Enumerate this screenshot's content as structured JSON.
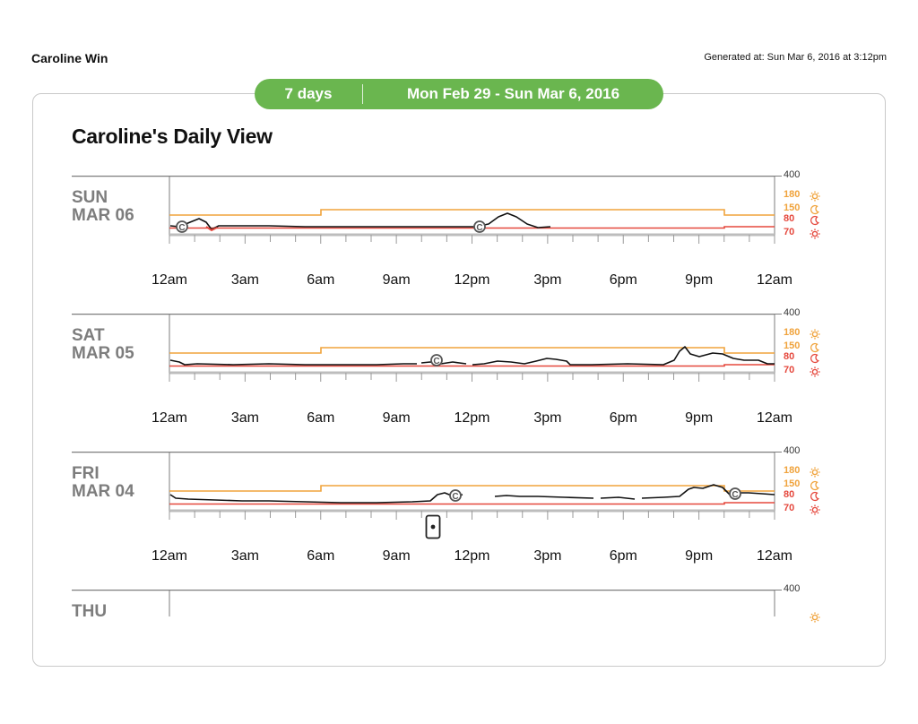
{
  "patient_name": "Caroline Win",
  "generated_at": "Generated at: Sun Mar 6, 2016 at 3:12pm",
  "banner": {
    "days": "7 days",
    "range": "Mon Feb 29 - Sun Mar 6, 2016"
  },
  "page_title": "Caroline's Daily View",
  "hour_labels": [
    "12am",
    "3am",
    "6am",
    "9am",
    "12pm",
    "3pm",
    "6pm",
    "9pm",
    "12am"
  ],
  "range_labels": {
    "max": "400",
    "day_high": "180",
    "night_high": "150",
    "night_low": "80",
    "day_low": "70"
  },
  "colors": {
    "green": "#6ab64f",
    "orange": "#f0a33c",
    "red": "#e5483d",
    "trace": "#111111",
    "grey": "#7d7d7d"
  },
  "icons": {
    "day_high": "sun-icon",
    "night_high": "moon-icon",
    "night_low": "moon-icon",
    "day_low": "sun-icon",
    "calibration": "calibration-c-icon",
    "device": "phone-device-icon"
  },
  "days": [
    {
      "dow": "SUN",
      "date": "MAR 06"
    },
    {
      "dow": "SAT",
      "date": "MAR 05"
    },
    {
      "dow": "FRI",
      "date": "MAR 04"
    },
    {
      "dow": "THU",
      "date": ""
    }
  ]
}
